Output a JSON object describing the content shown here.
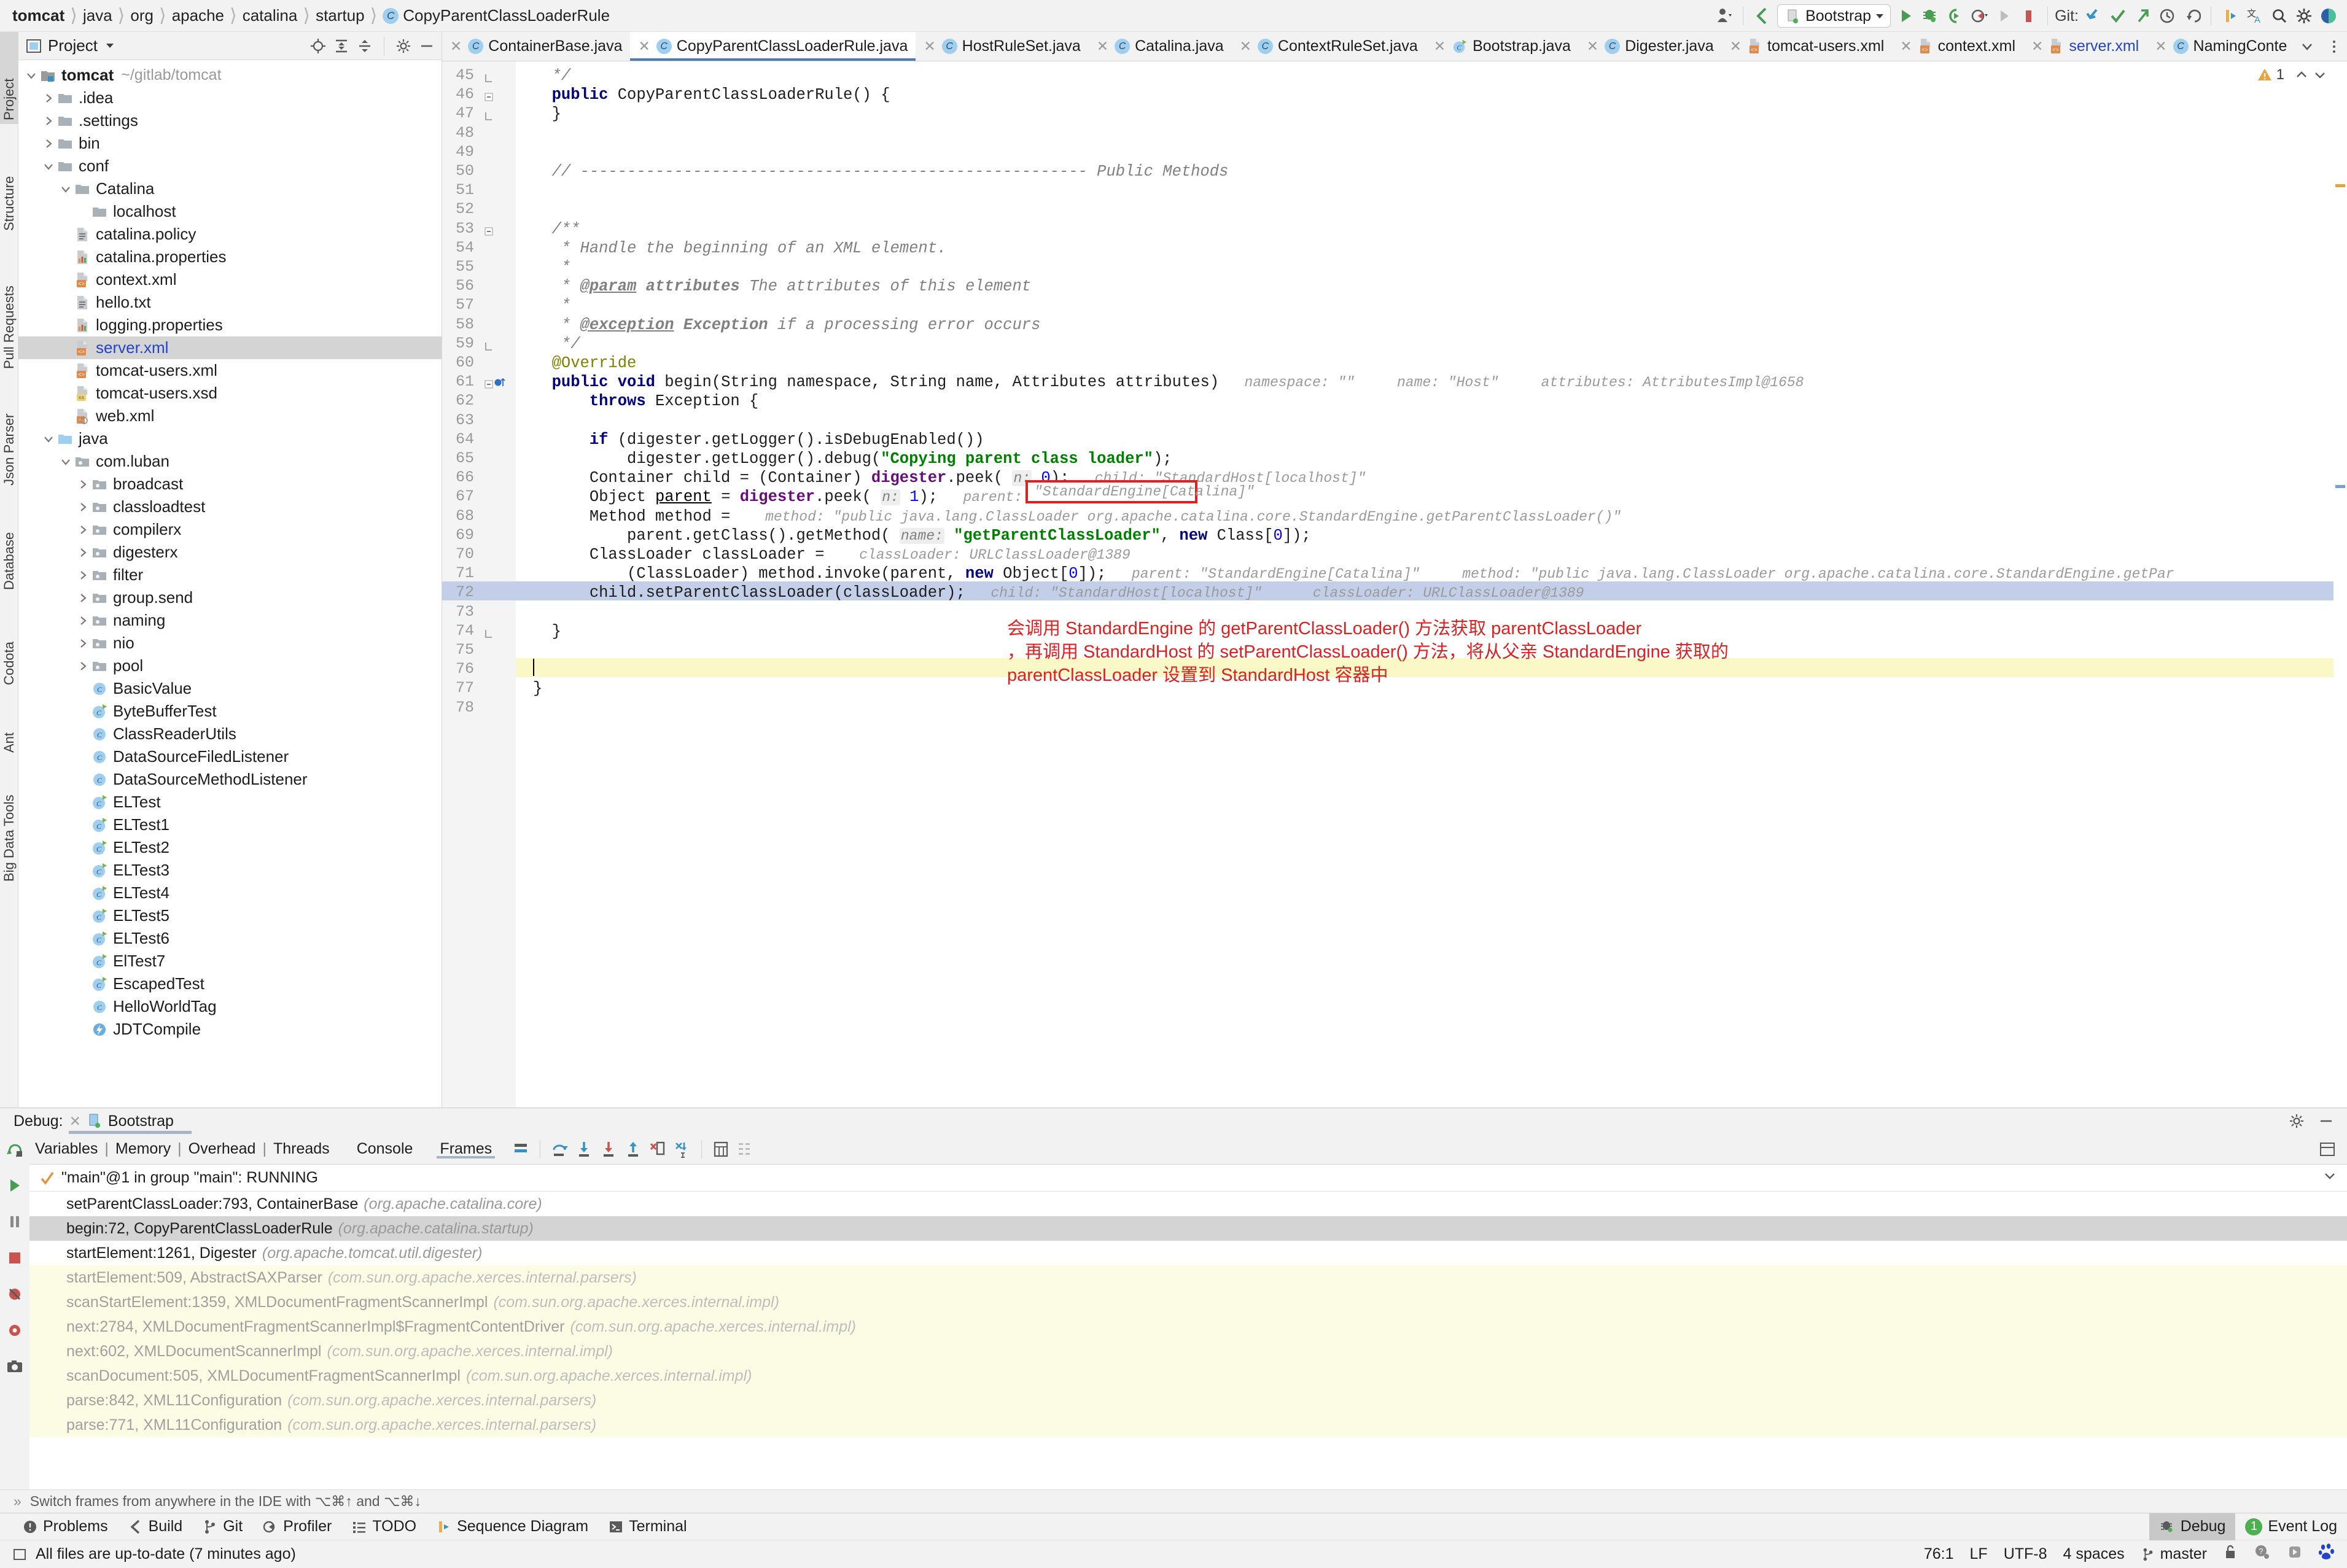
{
  "navbar": {
    "breadcrumb": [
      "tomcat",
      "java",
      "org",
      "apache",
      "catalina",
      "startup",
      "CopyParentClassLoaderRule"
    ],
    "run_config": "Bootstrap",
    "git_label": "Git:",
    "icons": [
      "profiler-icon",
      "back-icon",
      "run-icon",
      "debug-icon",
      "run-with-coverage-icon",
      "profile-icon",
      "rerun-icon",
      "stop-icon",
      "git-update-icon",
      "git-commit-icon",
      "git-push-icon",
      "git-history-icon",
      "git-rollback-icon",
      "bookmark-icon",
      "translate-icon",
      "search-icon",
      "settings-icon",
      "codota-icon"
    ]
  },
  "left_strip": {
    "tabs": [
      "Project",
      "Structure",
      "Pull Requests",
      "Json Parser",
      "Database",
      "Codota",
      "Ant",
      "Big Data Tools"
    ],
    "active": "Project"
  },
  "project_panel": {
    "title": "Project",
    "header_icons": [
      "locate-icon",
      "expand-all-icon",
      "collapse-all-icon",
      "gear-icon",
      "hide-icon"
    ],
    "tree": [
      {
        "depth": 0,
        "tw": "open",
        "icon": "module",
        "label": "tomcat",
        "bold": true,
        "path": "~/gitlab/tomcat"
      },
      {
        "depth": 1,
        "tw": "closed",
        "icon": "folder",
        "label": ".idea"
      },
      {
        "depth": 1,
        "tw": "closed",
        "icon": "folder",
        "label": ".settings"
      },
      {
        "depth": 1,
        "tw": "closed",
        "icon": "folder",
        "label": "bin"
      },
      {
        "depth": 1,
        "tw": "open",
        "icon": "folder",
        "label": "conf"
      },
      {
        "depth": 2,
        "tw": "open",
        "icon": "folder",
        "label": "Catalina"
      },
      {
        "depth": 3,
        "tw": "none",
        "icon": "folder",
        "label": "localhost"
      },
      {
        "depth": 2,
        "tw": "none",
        "icon": "textfile",
        "label": "catalina.policy"
      },
      {
        "depth": 2,
        "tw": "none",
        "icon": "propfile",
        "label": "catalina.properties"
      },
      {
        "depth": 2,
        "tw": "none",
        "icon": "xmlfile",
        "label": "context.xml"
      },
      {
        "depth": 2,
        "tw": "none",
        "icon": "textfile",
        "label": "hello.txt"
      },
      {
        "depth": 2,
        "tw": "none",
        "icon": "propfile",
        "label": "logging.properties"
      },
      {
        "depth": 2,
        "tw": "none",
        "icon": "xmlfile",
        "label": "server.xml",
        "selected": true,
        "blue": true
      },
      {
        "depth": 2,
        "tw": "none",
        "icon": "xmlfile",
        "label": "tomcat-users.xml"
      },
      {
        "depth": 2,
        "tw": "none",
        "icon": "xsdfile",
        "label": "tomcat-users.xsd"
      },
      {
        "depth": 2,
        "tw": "none",
        "icon": "webxmlfile",
        "label": "web.xml"
      },
      {
        "depth": 1,
        "tw": "open",
        "icon": "srcfolder",
        "label": "java"
      },
      {
        "depth": 2,
        "tw": "open",
        "icon": "package",
        "label": "com.luban"
      },
      {
        "depth": 3,
        "tw": "closed",
        "icon": "package",
        "label": "broadcast"
      },
      {
        "depth": 3,
        "tw": "closed",
        "icon": "package",
        "label": "classloadtest"
      },
      {
        "depth": 3,
        "tw": "closed",
        "icon": "package",
        "label": "compilerx"
      },
      {
        "depth": 3,
        "tw": "closed",
        "icon": "package",
        "label": "digesterx"
      },
      {
        "depth": 3,
        "tw": "closed",
        "icon": "package",
        "label": "filter"
      },
      {
        "depth": 3,
        "tw": "closed",
        "icon": "package",
        "label": "group.send"
      },
      {
        "depth": 3,
        "tw": "closed",
        "icon": "package",
        "label": "naming"
      },
      {
        "depth": 3,
        "tw": "closed",
        "icon": "package",
        "label": "nio"
      },
      {
        "depth": 3,
        "tw": "closed",
        "icon": "package",
        "label": "pool"
      },
      {
        "depth": 3,
        "tw": "none",
        "icon": "class",
        "label": "BasicValue"
      },
      {
        "depth": 3,
        "tw": "none",
        "icon": "runclass",
        "label": "ByteBufferTest"
      },
      {
        "depth": 3,
        "tw": "none",
        "icon": "class",
        "label": "ClassReaderUtils"
      },
      {
        "depth": 3,
        "tw": "none",
        "icon": "class",
        "label": "DataSourceFiledListener"
      },
      {
        "depth": 3,
        "tw": "none",
        "icon": "class",
        "label": "DataSourceMethodListener"
      },
      {
        "depth": 3,
        "tw": "none",
        "icon": "runclass",
        "label": "ELTest"
      },
      {
        "depth": 3,
        "tw": "none",
        "icon": "runclass",
        "label": "ELTest1"
      },
      {
        "depth": 3,
        "tw": "none",
        "icon": "runclass",
        "label": "ELTest2"
      },
      {
        "depth": 3,
        "tw": "none",
        "icon": "runclass",
        "label": "ELTest3"
      },
      {
        "depth": 3,
        "tw": "none",
        "icon": "runclass",
        "label": "ELTest4"
      },
      {
        "depth": 3,
        "tw": "none",
        "icon": "runclass",
        "label": "ELTest5"
      },
      {
        "depth": 3,
        "tw": "none",
        "icon": "runclass",
        "label": "ELTest6"
      },
      {
        "depth": 3,
        "tw": "none",
        "icon": "runclass",
        "label": "ElTest7"
      },
      {
        "depth": 3,
        "tw": "none",
        "icon": "runclass",
        "label": "EscapedTest"
      },
      {
        "depth": 3,
        "tw": "none",
        "icon": "class",
        "label": "HelloWorldTag"
      },
      {
        "depth": 3,
        "tw": "none",
        "icon": "boltclass",
        "label": "JDTCompile"
      }
    ]
  },
  "editor_tabs": [
    {
      "label": "ContainerBase.java",
      "icon": "class"
    },
    {
      "label": "CopyParentClassLoaderRule.java",
      "icon": "class",
      "active": true
    },
    {
      "label": "HostRuleSet.java",
      "icon": "class"
    },
    {
      "label": "Catalina.java",
      "icon": "class"
    },
    {
      "label": "ContextRuleSet.java",
      "icon": "class"
    },
    {
      "label": "Bootstrap.java",
      "icon": "runclass"
    },
    {
      "label": "Digester.java",
      "icon": "class"
    },
    {
      "label": "tomcat-users.xml",
      "icon": "xml"
    },
    {
      "label": "context.xml",
      "icon": "xml"
    },
    {
      "label": "server.xml",
      "icon": "xml",
      "blue": true
    },
    {
      "label": "NamingConte",
      "icon": "class"
    }
  ],
  "editor": {
    "warning_count": "1",
    "first_line": 45,
    "last_line": 78,
    "lines": [
      {
        "n": 45,
        "fold": "end",
        "segs": [
          {
            "t": "  */",
            "c": "cmt"
          }
        ]
      },
      {
        "n": 46,
        "fold": "collapse",
        "segs": [
          {
            "t": "  ",
            "c": ""
          },
          {
            "t": "public",
            "c": "kw"
          },
          {
            "t": " CopyParentClassLoaderRule() {",
            "c": ""
          }
        ]
      },
      {
        "n": 47,
        "fold": "end",
        "segs": [
          {
            "t": "  }",
            "c": ""
          }
        ]
      },
      {
        "n": 48,
        "segs": []
      },
      {
        "n": 49,
        "segs": []
      },
      {
        "n": 50,
        "segs": [
          {
            "t": "  // ------------------------------------------------------ Public Methods",
            "c": "cmt"
          }
        ]
      },
      {
        "n": 51,
        "segs": []
      },
      {
        "n": 52,
        "segs": []
      },
      {
        "n": 53,
        "fold": "collapse",
        "segs": [
          {
            "t": "  /**",
            "c": "cmt"
          }
        ]
      },
      {
        "n": 54,
        "segs": [
          {
            "t": "   * Handle the beginning of an XML element.",
            "c": "cmt"
          }
        ]
      },
      {
        "n": 55,
        "segs": [
          {
            "t": "   *",
            "c": "cmt"
          }
        ]
      },
      {
        "n": 56,
        "segs": [
          {
            "t": "   * ",
            "c": "cmt"
          },
          {
            "t": "@param",
            "c": "cmtdoc"
          },
          {
            "t": " ",
            "c": "cmt"
          },
          {
            "t": "attributes",
            "c": "cmtparam"
          },
          {
            "t": " The attributes of this element",
            "c": "cmt"
          }
        ]
      },
      {
        "n": 57,
        "segs": [
          {
            "t": "   *",
            "c": "cmt"
          }
        ]
      },
      {
        "n": 58,
        "segs": [
          {
            "t": "   * ",
            "c": "cmt"
          },
          {
            "t": "@exception",
            "c": "cmtdoc"
          },
          {
            "t": " ",
            "c": "cmt"
          },
          {
            "t": "Exception",
            "c": "cmtparam"
          },
          {
            "t": " if a processing error occurs",
            "c": "cmt"
          }
        ]
      },
      {
        "n": 59,
        "fold": "end",
        "segs": [
          {
            "t": "   */",
            "c": "cmt"
          }
        ]
      },
      {
        "n": 60,
        "segs": [
          {
            "t": "  @Override",
            "c": "anno"
          }
        ]
      },
      {
        "n": 61,
        "bp": true,
        "fold": "collapse",
        "segs": [
          {
            "t": "  ",
            "c": ""
          },
          {
            "t": "public",
            "c": "kw"
          },
          {
            "t": " ",
            "c": ""
          },
          {
            "t": "void",
            "c": "kw"
          },
          {
            "t": " begin(String namespace, String name, Attributes attributes)",
            "c": ""
          }
        ],
        "hints": "namespace: \"\"     name: \"Host\"     attributes: AttributesImpl@1658"
      },
      {
        "n": 62,
        "segs": [
          {
            "t": "      ",
            "c": ""
          },
          {
            "t": "throws",
            "c": "kw"
          },
          {
            "t": " Exception {",
            "c": ""
          }
        ]
      },
      {
        "n": 63,
        "segs": []
      },
      {
        "n": 64,
        "segs": [
          {
            "t": "      ",
            "c": ""
          },
          {
            "t": "if",
            "c": "kw"
          },
          {
            "t": " (digester.getLogger().isDebugEnabled())",
            "c": ""
          }
        ]
      },
      {
        "n": 65,
        "segs": [
          {
            "t": "          digester.getLogger().debug(",
            "c": ""
          },
          {
            "t": "\"Copying parent class loader\"",
            "c": "str"
          },
          {
            "t": ");",
            "c": ""
          }
        ]
      },
      {
        "n": 66,
        "segs": [
          {
            "t": "      Container child = (Container) ",
            "c": ""
          },
          {
            "t": "digester",
            "c": "fld"
          },
          {
            "t": ".peek( ",
            "c": ""
          },
          {
            "t": "n:",
            "c": "hintp"
          },
          {
            "t": " ",
            "c": ""
          },
          {
            "t": "0",
            "c": "num"
          },
          {
            "t": ");",
            "c": ""
          }
        ],
        "hints": "child: \"StandardHost[localhost]\""
      },
      {
        "n": 67,
        "segs": [
          {
            "t": "      Object ",
            "c": ""
          },
          {
            "t": "parent",
            "c": "link"
          },
          {
            "t": " = ",
            "c": ""
          },
          {
            "t": "digester",
            "c": "fld"
          },
          {
            "t": ".peek( ",
            "c": ""
          },
          {
            "t": "n:",
            "c": "hintp"
          },
          {
            "t": " ",
            "c": ""
          },
          {
            "t": "1",
            "c": "num"
          },
          {
            "t": ");",
            "c": ""
          }
        ],
        "hints": "parent:",
        "boxed_value": "\"StandardEngine[Catalina]\""
      },
      {
        "n": 68,
        "segs": [
          {
            "t": "      Method method = ",
            "c": ""
          }
        ],
        "hints": "method: \"public java.lang.ClassLoader org.apache.catalina.core.StandardEngine.getParentClassLoader()\""
      },
      {
        "n": 69,
        "segs": [
          {
            "t": "          parent.getClass().getMethod( ",
            "c": ""
          },
          {
            "t": "name:",
            "c": "hintp"
          },
          {
            "t": " ",
            "c": ""
          },
          {
            "t": "\"getParentClassLoader\"",
            "c": "str"
          },
          {
            "t": ", ",
            "c": ""
          },
          {
            "t": "new",
            "c": "kw"
          },
          {
            "t": " Class[",
            "c": ""
          },
          {
            "t": "0",
            "c": "num"
          },
          {
            "t": "]);",
            "c": ""
          }
        ]
      },
      {
        "n": 70,
        "segs": [
          {
            "t": "      ClassLoader classLoader = ",
            "c": ""
          }
        ],
        "hints": "classLoader: URLClassLoader@1389"
      },
      {
        "n": 71,
        "segs": [
          {
            "t": "          (ClassLoader) method.invoke(parent, ",
            "c": ""
          },
          {
            "t": "new",
            "c": "kw"
          },
          {
            "t": " Object[",
            "c": ""
          },
          {
            "t": "0",
            "c": "num"
          },
          {
            "t": "]);",
            "c": ""
          }
        ],
        "hints": "parent: \"StandardEngine[Catalina]\"     method: \"public java.lang.ClassLoader org.apache.catalina.core.StandardEngine.getPar"
      },
      {
        "n": 72,
        "current": true,
        "segs": [
          {
            "t": "      child.setParentClassLoader(classLoader);",
            "c": ""
          }
        ],
        "hints": "child: \"StandardHost[localhost]\"      classLoader: URLClassLoader@1389"
      },
      {
        "n": 73,
        "segs": []
      },
      {
        "n": 74,
        "fold": "end",
        "segs": [
          {
            "t": "  }",
            "c": ""
          }
        ]
      },
      {
        "n": 75,
        "segs": []
      },
      {
        "n": 76,
        "caret": true,
        "segs": []
      },
      {
        "n": 77,
        "segs": [
          {
            "t": "}",
            "c": ""
          }
        ]
      },
      {
        "n": 78,
        "segs": []
      }
    ],
    "annotation": [
      "会调用 StandardEngine 的 getParentClassLoader() 方法获取 parentClassLoader",
      "，再调用 StandardHost 的 setParentClassLoader() 方法，将从父亲 StandardEngine 获取的",
      "parentClassLoader 设置到 StandardHost 容器中"
    ],
    "annotation_color": "#e02020"
  },
  "debug": {
    "title": "Debug:",
    "session": "Bootstrap",
    "tabs": [
      "Variables",
      "Memory",
      "Overhead",
      "Threads"
    ],
    "tab_console": "Console",
    "tab_frames": "Frames",
    "toolbar_icons": [
      "layout-icon",
      "step-over-icon",
      "step-into-icon",
      "force-step-into-icon",
      "step-out-icon",
      "drop-frame-icon",
      "run-to-cursor-icon",
      "evaluate-icon",
      "settings2-icon"
    ],
    "left_icons": [
      "rerun-icon",
      "resume-icon",
      "pause-icon",
      "stop-icon",
      "mute-breakpoints-icon",
      "view-breakpoints-icon",
      "camera-icon"
    ],
    "thread": "\"main\"@1 in group \"main\": RUNNING",
    "frames": [
      {
        "text": "setParentClassLoader:793, ContainerBase",
        "pkg": "(org.apache.catalina.core)"
      },
      {
        "text": "begin:72, CopyParentClassLoaderRule",
        "pkg": "(org.apache.catalina.startup)",
        "selected": true
      },
      {
        "text": "startElement:1261, Digester",
        "pkg": "(org.apache.tomcat.util.digester)"
      },
      {
        "text": "startElement:509, AbstractSAXParser",
        "pkg": "(com.sun.org.apache.xerces.internal.parsers)",
        "lib": true
      },
      {
        "text": "scanStartElement:1359, XMLDocumentFragmentScannerImpl",
        "pkg": "(com.sun.org.apache.xerces.internal.impl)",
        "lib": true
      },
      {
        "text": "next:2784, XMLDocumentFragmentScannerImpl$FragmentContentDriver",
        "pkg": "(com.sun.org.apache.xerces.internal.impl)",
        "lib": true
      },
      {
        "text": "next:602, XMLDocumentScannerImpl",
        "pkg": "(com.sun.org.apache.xerces.internal.impl)",
        "lib": true
      },
      {
        "text": "scanDocument:505, XMLDocumentFragmentScannerImpl",
        "pkg": "(com.sun.org.apache.xerces.internal.impl)",
        "lib": true
      },
      {
        "text": "parse:842, XML11Configuration",
        "pkg": "(com.sun.org.apache.xerces.internal.parsers)",
        "lib": true
      },
      {
        "text": "parse:771, XML11Configuration",
        "pkg": "(com.sun.org.apache.xerces.internal.parsers)",
        "lib": true
      }
    ],
    "hint": "Switch frames from anywhere in the IDE with ⌥⌘↑ and ⌥⌘↓"
  },
  "bottom_toolbar": {
    "items": [
      {
        "label": "Problems",
        "icon": "problems-icon"
      },
      {
        "label": "Build",
        "icon": "build-icon"
      },
      {
        "label": "Git",
        "icon": "git-icon"
      },
      {
        "label": "Profiler",
        "icon": "profiler-icon"
      },
      {
        "label": "TODO",
        "icon": "todo-icon"
      },
      {
        "label": "Sequence Diagram",
        "icon": "sequence-icon"
      },
      {
        "label": "Terminal",
        "icon": "terminal-icon"
      }
    ],
    "right_tabs": [
      {
        "label": "Debug",
        "icon": "debug-icon",
        "active": true
      },
      {
        "label": "Event Log",
        "icon": "event-log-icon",
        "badge": "1"
      }
    ]
  },
  "statusbar": {
    "message": "All files are up-to-date (7 minutes ago)",
    "caret": "76:1",
    "line_sep": "LF",
    "encoding": "UTF-8",
    "indent": "4 spaces",
    "branch": "master",
    "icons": [
      "lock-icon",
      "question-icon",
      "plugin-icon",
      "baidu-icon"
    ]
  }
}
